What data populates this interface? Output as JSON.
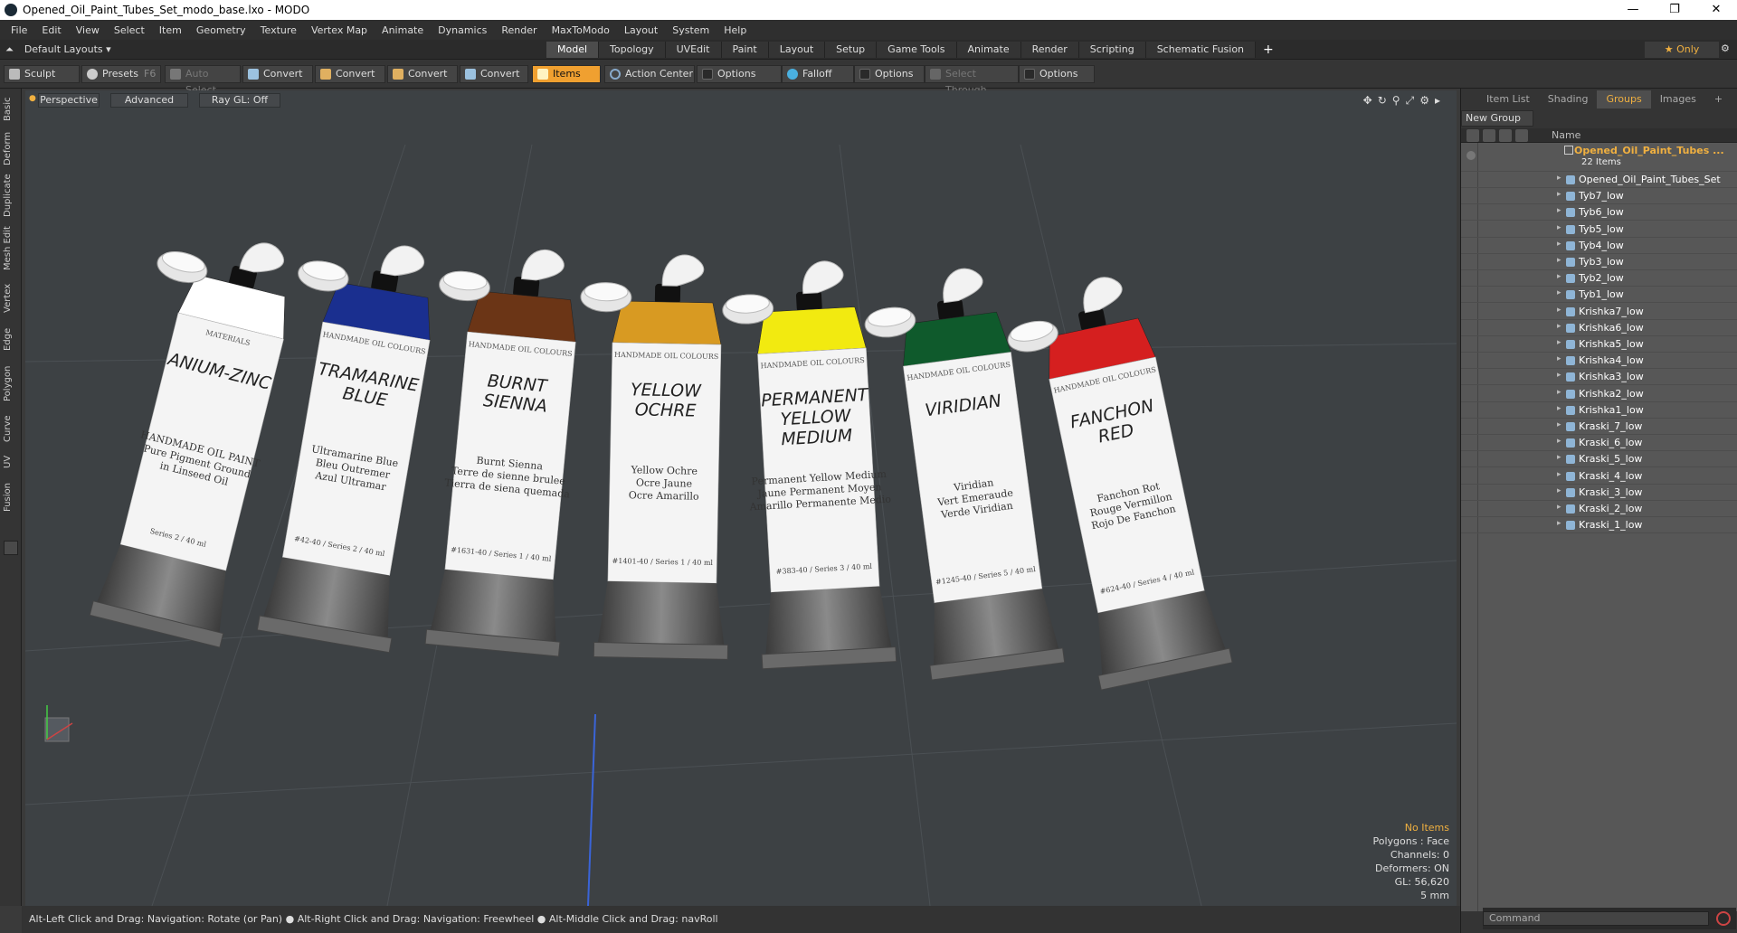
{
  "window": {
    "title": "Opened_Oil_Paint_Tubes_Set_modo_base.lxo - MODO",
    "min": "—",
    "max": "❐",
    "close": "✕"
  },
  "menu": [
    "File",
    "Edit",
    "View",
    "Select",
    "Item",
    "Geometry",
    "Texture",
    "Vertex Map",
    "Animate",
    "Dynamics",
    "Render",
    "MaxToModo",
    "Layout",
    "System",
    "Help"
  ],
  "tabbar": {
    "layouts_label": "Default Layouts ▾",
    "tabs": [
      "Model",
      "Topology",
      "UVEdit",
      "Paint",
      "Layout",
      "Setup",
      "Game Tools",
      "Animate",
      "Render",
      "Scripting",
      "Schematic Fusion"
    ],
    "active_tab": "Model",
    "only_label": "★  Only"
  },
  "toolbar": {
    "sculpt": "Sculpt",
    "presets": "Presets",
    "presets_hotkey": "F6",
    "auto_select": "Auto Select",
    "convert1": "Convert",
    "convert2": "Convert",
    "convert3": "Convert",
    "convert4": "Convert",
    "items": "Items",
    "action_center": "Action Center",
    "options1": "Options",
    "falloff": "Falloff",
    "options2": "Options",
    "select_through": "Select Through",
    "options3": "Options"
  },
  "left_tabs": [
    "Basic",
    "Deform",
    "Duplicate",
    "Mesh Edit",
    "Vertex",
    "Edge",
    "Polygon",
    "Curve",
    "UV",
    "Fusion"
  ],
  "viewport": {
    "view_mode": "Perspective",
    "shading": "Advanced",
    "raygl": "Ray GL: Off",
    "tubes": [
      {
        "color": "#ffffff",
        "label_lines": [
          "ANIUM-ZINC"
        ],
        "brand": "MATERIALS",
        "sub": [
          "HANDMADE OIL PAINT",
          "Pure Pigment Ground",
          "in Linseed Oil"
        ],
        "series": "Series 2 / 40 ml"
      },
      {
        "color": "#1a2f8f",
        "label_lines": [
          "TRAMARINE",
          "BLUE"
        ],
        "brand": "HANDMADE OIL COLOURS",
        "sub": [
          "Ultramarine Blue",
          "Bleu Outremer",
          "Azul Ultramar"
        ],
        "series": "#42-40 / Series 2 / 40 ml"
      },
      {
        "color": "#6b3516",
        "label_lines": [
          "BURNT",
          "SIENNA"
        ],
        "brand": "HANDMADE OIL COLOURS",
        "sub": [
          "Burnt Sienna",
          "Terre de sienne brulee",
          "Tierra de siena quemada"
        ],
        "series": "#1631-40 / Series 1 / 40 ml"
      },
      {
        "color": "#d89a22",
        "label_lines": [
          "YELLOW",
          "OCHRE"
        ],
        "brand": "HANDMADE OIL COLOURS",
        "sub": [
          "Yellow Ochre",
          "Ocre Jaune",
          "Ocre Amarillo"
        ],
        "series": "#1401-40 / Series 1 / 40 ml"
      },
      {
        "color": "#f2ea10",
        "label_lines": [
          "PERMANENT",
          "YELLOW",
          "MEDIUM"
        ],
        "brand": "HANDMADE OIL COLOURS",
        "sub": [
          "Permanent Yellow Medium",
          "Jaune Permanent Moyen",
          "Amarillo Permanente Medio"
        ],
        "series": "#383-40 / Series 3 / 40 ml"
      },
      {
        "color": "#0f5a2c",
        "label_lines": [
          "VIRIDIAN"
        ],
        "brand": "HANDMADE OIL COLOURS",
        "sub": [
          "Viridian",
          "Vert Emeraude",
          "Verde Viridian"
        ],
        "series": "#1245-40 / Series 5 / 40 ml"
      },
      {
        "color": "#d51f1f",
        "label_lines": [
          "FANCHON",
          "RED"
        ],
        "brand": "HANDMADE OIL COLOURS",
        "sub": [
          "Fanchon Rot",
          "Rouge Vermillon",
          "Rojo De Fanchon"
        ],
        "series": "#624-40 / Series 4 / 40 ml"
      }
    ]
  },
  "stats": {
    "selection": "No Items",
    "polygons": "Polygons : Face",
    "channels": "Channels: 0",
    "deformers": "Deformers: ON",
    "gl": "GL: 56,620",
    "scale": "5 mm"
  },
  "statusbar": {
    "text": "Alt-Left Click and Drag: Navigation: Rotate (or Pan) ● Alt-Right Click and Drag: Navigation: Freewheel ● Alt-Middle Click and Drag: navRoll"
  },
  "right_panel": {
    "tabs": [
      "Item List",
      "Shading",
      "Groups",
      "Images"
    ],
    "active_tab": "Groups",
    "plus": "+",
    "new_group": "New Group",
    "name_col": "Name",
    "group_name": "Opened_Oil_Paint_Tubes ...",
    "group_count": "22 Items",
    "items": [
      "Opened_Oil_Paint_Tubes_Set",
      "Tyb7_low",
      "Tyb6_low",
      "Tyb5_low",
      "Tyb4_low",
      "Tyb3_low",
      "Tyb2_low",
      "Tyb1_low",
      "Krishka7_low",
      "Krishka6_low",
      "Krishka5_low",
      "Krishka4_low",
      "Krishka3_low",
      "Krishka2_low",
      "Krishka1_low",
      "Kraski_7_low",
      "Kraski_6_low",
      "Kraski_5_low",
      "Kraski_4_low",
      "Kraski_3_low",
      "Kraski_2_low",
      "Kraski_1_low"
    ],
    "command_placeholder": "Command"
  }
}
